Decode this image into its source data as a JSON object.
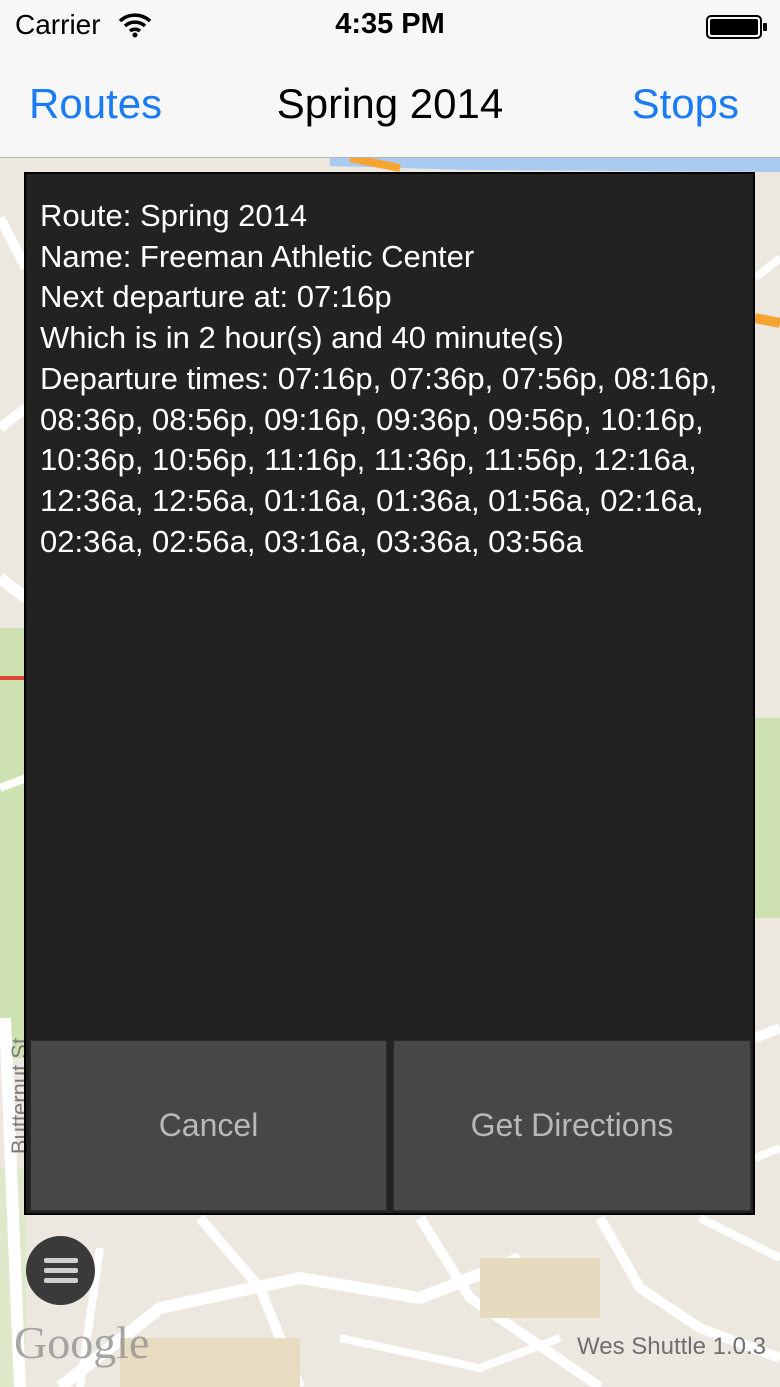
{
  "status_bar": {
    "carrier": "Carrier",
    "time": "4:35 PM",
    "wifi_icon": "wifi-icon",
    "battery_icon": "battery-full-icon"
  },
  "nav": {
    "left_button": "Routes",
    "title": "Spring 2014",
    "right_button": "Stops"
  },
  "dialog": {
    "lines": [
      "Route: Spring 2014",
      "Name: Freeman Athletic Center",
      "Next departure at: 07:16p",
      "Which is in 2 hour(s) and 40 minute(s)",
      "Departure times: 07:16p, 07:36p, 07:56p, 08:16p, 08:36p, 08:56p, 09:16p, 09:36p, 09:56p, 10:16p, 10:36p, 10:56p, 11:16p, 11:36p, 11:56p, 12:16a, 12:36a, 12:56a, 01:16a, 01:36a, 01:56a, 02:16a, 02:36a, 02:56a, 03:16a, 03:36a, 03:56a"
    ],
    "cancel_label": "Cancel",
    "directions_label": "Get Directions"
  },
  "map": {
    "street_label": "Butternut St",
    "attribution": "Google"
  },
  "overlay": {
    "menu_icon": "menu-icon",
    "version": "Wes Shuttle 1.0.3"
  },
  "colors": {
    "accent": "#1a7cf5",
    "dialog_background": "#121212",
    "dialog_button": "#474747",
    "map_land": "#ece7df",
    "map_park": "#cde2b0",
    "map_water": "#a9cbf2"
  }
}
